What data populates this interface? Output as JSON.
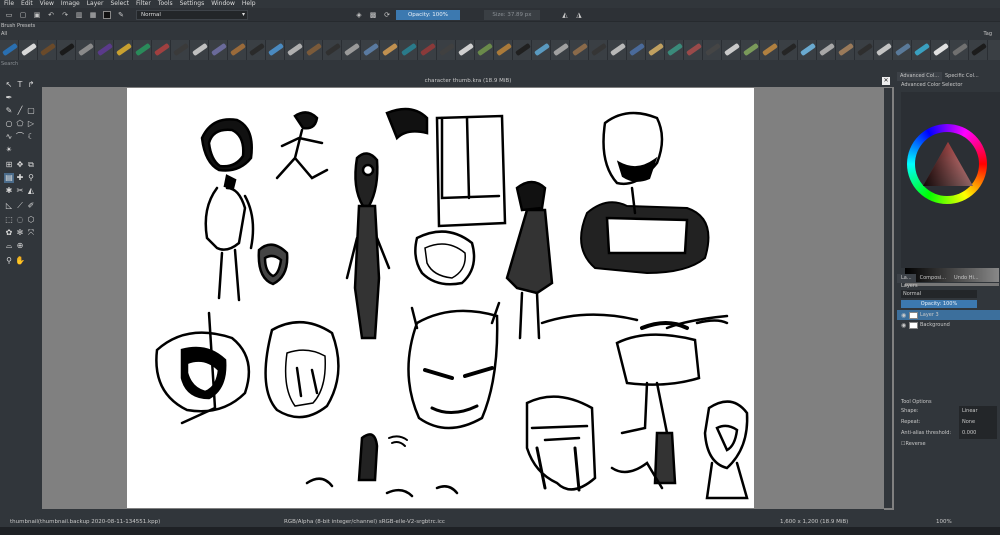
{
  "menu": [
    "File",
    "Edit",
    "View",
    "Image",
    "Layer",
    "Select",
    "Filter",
    "Tools",
    "Settings",
    "Window",
    "Help"
  ],
  "toolbar": {
    "blend_mode": "Normal",
    "opacity": "Opacity: 100%",
    "size": "Size: 37.89 px"
  },
  "brush_presets": {
    "title": "Brush Presets",
    "tag": "All",
    "tag_right": "Tag",
    "search": "Search",
    "colors": [
      "#2a6fb0",
      "#d9d9d9",
      "#6a4a2a",
      "#1a1a1a",
      "#8a8a8a",
      "#5a3a8a",
      "#c8a030",
      "#2a8a5a",
      "#a04040",
      "#3a3a3a",
      "#c0c0c0",
      "#6a6a9a",
      "#9a6a3a",
      "#2a2a2a",
      "#4a8ac0",
      "#b0b0b0",
      "#7a5a3a",
      "#303030",
      "#9a9a9a",
      "#5a7aa0",
      "#c09050",
      "#2a7a8a",
      "#8a3a3a",
      "#404040",
      "#d0d0d0",
      "#6a8a4a",
      "#aa7a3a",
      "#202020",
      "#5a9ac0",
      "#a0a0a0",
      "#8a6a4a",
      "#353535",
      "#b8b8b8",
      "#4a6a9a",
      "#c0a060",
      "#3a8a7a",
      "#9a4a4a",
      "#454545",
      "#cacaca",
      "#7a9a5a",
      "#b08040",
      "#252525",
      "#6aaad0",
      "#a8a8a8",
      "#9a7a5a",
      "#2e2e2e",
      "#c4c4c4",
      "#5a7a9a",
      "#3aa0c0",
      "#e0e0e0",
      "#707070",
      "#1c1c1c"
    ]
  },
  "document": {
    "title": "character thumb.kra (18.9 MiB)"
  },
  "docker": {
    "tabs": [
      "Advanced Col...",
      "Specific Col..."
    ],
    "selector_label": "Advanced Color Selector",
    "layer_tabs": [
      "La...",
      "Composi...",
      "Undo Hi..."
    ],
    "layers_label": "Layers",
    "layer_blend": "Normal",
    "layer_opacity": "Opacity: 100%",
    "layers": [
      {
        "name": "Layer 3",
        "selected": true
      },
      {
        "name": "Background",
        "selected": false
      }
    ],
    "tool_options_title": "Tool Options",
    "options": [
      {
        "label": "Shape:",
        "value": "Linear"
      },
      {
        "label": "Repeat:",
        "value": "None"
      },
      {
        "label": "Anti-alias threshold:",
        "value": "0.000"
      }
    ],
    "reverse_label": "Reverse"
  },
  "status": {
    "file": "thumbnail(thumbnail.backup 2020-08-11-134551.kpp)",
    "color": "RGB/Alpha (8-bit integer/channel)  sRGB-elle-V2-srgbtrc.icc",
    "size": "1,600 x 1,200 (18.9 MiB)",
    "zoom": "100%"
  }
}
